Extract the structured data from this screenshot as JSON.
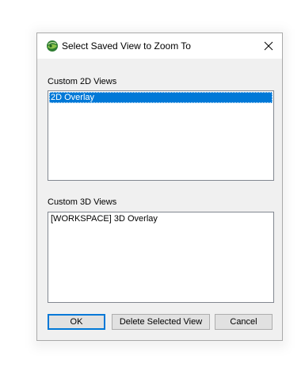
{
  "dialog": {
    "title": "Select Saved View to Zoom To",
    "icons": {
      "app": "globe-app-icon",
      "close": "close-icon"
    }
  },
  "views_2d": {
    "label": "Custom 2D Views",
    "items": [
      "2D Overlay"
    ],
    "selected_index": 0
  },
  "views_3d": {
    "label": "Custom 3D Views",
    "items": [
      "[WORKSPACE] 3D Overlay"
    ]
  },
  "buttons": {
    "ok": "OK",
    "delete": "Delete Selected View",
    "cancel": "Cancel"
  },
  "colors": {
    "selection": "#0078d7",
    "dialog_bg": "#f0f0f0",
    "titlebar_bg": "#ffffff"
  }
}
